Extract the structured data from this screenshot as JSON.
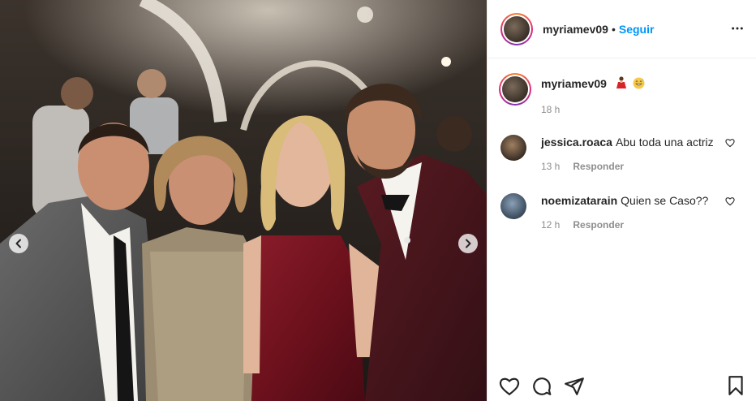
{
  "header": {
    "username": "myriamev09",
    "separator": "•",
    "follow_label": "Seguir"
  },
  "caption": {
    "username": "myriamev09",
    "emojis": [
      "dancer-emoji",
      "grinning-sweat-emoji"
    ],
    "time": "18 h"
  },
  "comments": [
    {
      "username": "jessica.roaca",
      "text": "Abu toda una actriz",
      "time": "13 h",
      "reply_label": "Responder"
    },
    {
      "username": "noemizatarain",
      "text": "Quien se Caso??",
      "time": "12 h",
      "reply_label": "Responder"
    }
  ],
  "icons": {
    "like": "heart-icon",
    "comment": "comment-icon",
    "share": "share-icon",
    "save": "bookmark-icon",
    "more": "more-options-icon",
    "prev": "chevron-left-icon",
    "next": "chevron-right-icon"
  },
  "colors": {
    "accent": "#0095f6",
    "text": "#262626",
    "muted": "#8e8e8e",
    "divider": "#efefef"
  }
}
